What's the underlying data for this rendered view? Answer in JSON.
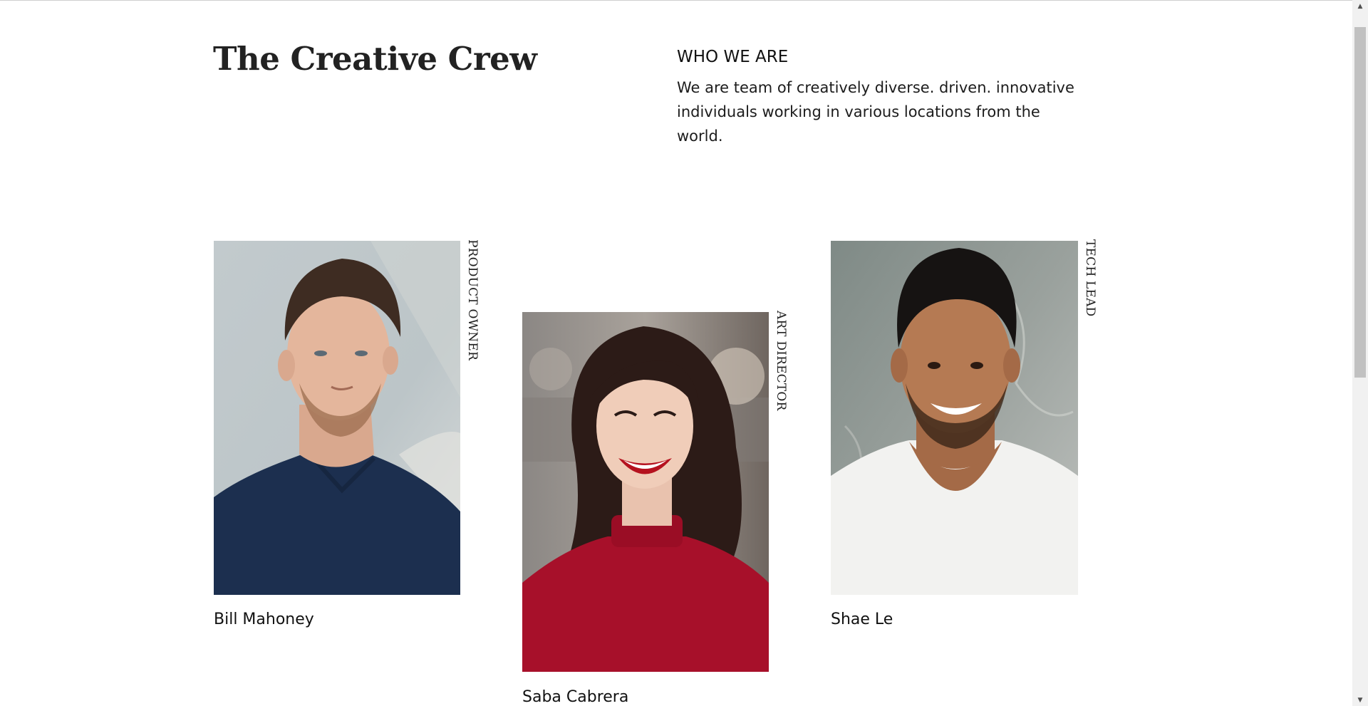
{
  "header": {
    "title": "The Creative Crew"
  },
  "about": {
    "heading": "WHO WE ARE",
    "text": "We are team of creatively diverse. driven. innovative individuals working in various locations from the world."
  },
  "team": [
    {
      "name": "Bill Mahoney",
      "role": "PRODUCT OWNER",
      "photo": "man-navy-polo-portrait"
    },
    {
      "name": "Saba Cabrera",
      "role": "ART DIRECTOR",
      "photo": "woman-red-sweater-portrait"
    },
    {
      "name": "Shae Le",
      "role": "TECH LEAD",
      "photo": "man-white-tshirt-portrait"
    }
  ],
  "colors": {
    "background": "#ffffff",
    "text": "#111111",
    "scrollbar_track": "#f1f1f1",
    "scrollbar_thumb": "#c1c1c1"
  },
  "icons": {
    "scroll_up": "▲",
    "scroll_down": "▼"
  }
}
